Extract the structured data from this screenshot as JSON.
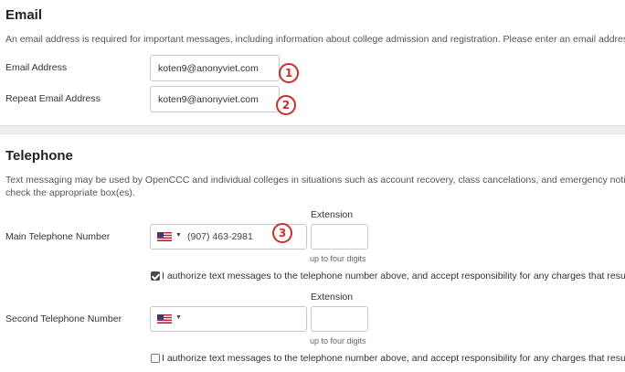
{
  "email_section": {
    "title": "Email",
    "description": "An email address is required for important messages, including information about college admission and registration. Please enter an email address that",
    "email_label": "Email Address",
    "email_value": "koten9@anonyviet.com",
    "repeat_label": "Repeat Email Address",
    "repeat_value": "koten9@anonyviet.com"
  },
  "telephone_section": {
    "title": "Telephone",
    "description_line1": "Text messaging may be used by OpenCCC and individual colleges in situations such as account recovery, class cancelations, and emergency notification",
    "description_line2": "check the appropriate box(es).",
    "main_label": "Main Telephone Number",
    "main_value": "(907) 463-2981",
    "second_label": "Second Telephone Number",
    "second_value": "",
    "extension_label": "Extension",
    "extension_hint": "up to four digits",
    "authorize_text": "I authorize text messages to the telephone number above, and accept responsibility for any charges that result.",
    "main_authorized": true,
    "second_authorized": false
  },
  "annotations": [
    "1",
    "2",
    "3"
  ],
  "colors": {
    "annotation": "#c9302c"
  }
}
